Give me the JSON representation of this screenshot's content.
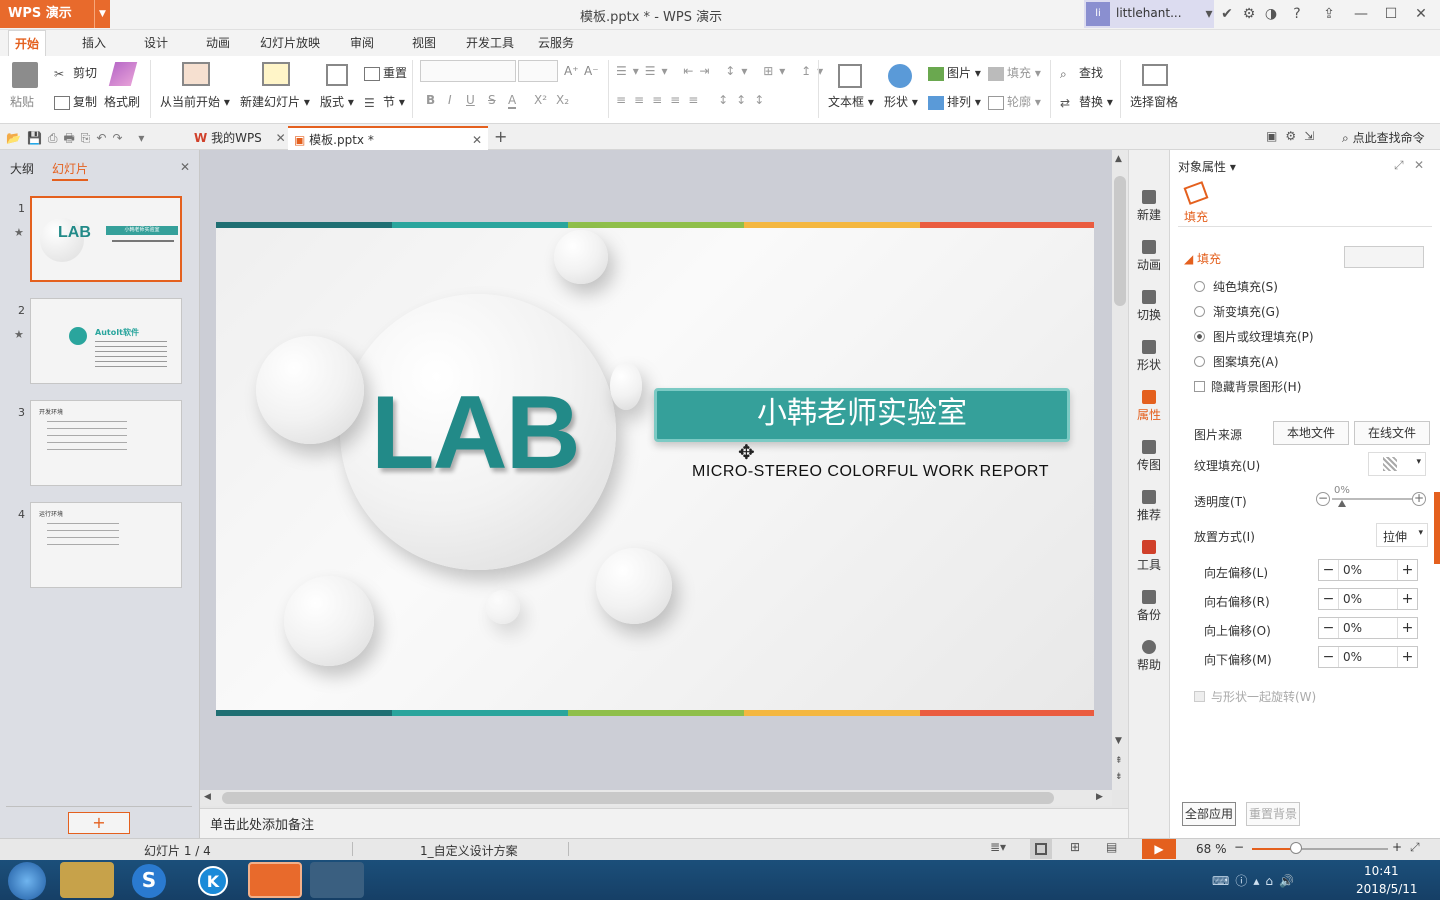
{
  "titlebar": {
    "app_name": "WPS 演示",
    "doc_title": "模板.pptx * - WPS 演示",
    "username": "littlehant...",
    "avatar_text": "li",
    "help": "?"
  },
  "menu": {
    "tabs": [
      "开始",
      "插入",
      "设计",
      "动画",
      "幻灯片放映",
      "审阅",
      "视图",
      "开发工具",
      "云服务"
    ]
  },
  "ribbon": {
    "paste": "粘贴",
    "cut": "剪切",
    "copy": "复制",
    "format_painter": "格式刷",
    "from_current": "从当前开始",
    "new_slide": "新建幻灯片",
    "layout": "版式",
    "reset": "重置",
    "section": "节",
    "textbox": "文本框",
    "shape": "形状",
    "picture": "图片",
    "fill": "填充",
    "arrange": "排列",
    "outline": "轮廓",
    "find": "查找",
    "replace": "替换",
    "selection_pane": "选择窗格",
    "font_increase": "A⁺",
    "font_decrease": "A⁻",
    "bold": "B",
    "italic": "I",
    "underline": "U",
    "strike": "S",
    "font_color": "A",
    "superscript": "X²",
    "subscript": "X₂"
  },
  "doc_tabs": {
    "my_wps": "我的WPS",
    "file": "模板.pptx *",
    "search_cmd": "点此查找命令"
  },
  "left_panel": {
    "tab_outline": "大纲",
    "tab_slides": "幻灯片",
    "slides": [
      {
        "num": "1",
        "star": "★",
        "title": "LAB",
        "sub": "小韩老师实验室"
      },
      {
        "num": "2",
        "star": "★",
        "title": "AutoIt软件"
      },
      {
        "num": "3",
        "star": "",
        "title": "开发环境"
      },
      {
        "num": "4",
        "star": "",
        "title": "运行环境"
      }
    ],
    "add_button": "+"
  },
  "slide": {
    "logo_text": "LAB",
    "title": "小韩老师实验室",
    "subtitle": "MICRO-STEREO COLORFUL WORK REPORT",
    "bar_colors": [
      "#1f6f73",
      "#2aa59d",
      "#8fbf4a",
      "#f4b740",
      "#ea5c40"
    ]
  },
  "notes": {
    "placeholder": "单击此处添加备注"
  },
  "side_tools": [
    "新建",
    "动画",
    "切换",
    "形状",
    "属性",
    "传图",
    "推荐",
    "工具",
    "备份",
    "帮助"
  ],
  "props": {
    "header": "对象属性",
    "tab_fill": "填充",
    "section_fill": "填充",
    "options": [
      "纯色填充(S)",
      "渐变填充(G)",
      "图片或纹理填充(P)",
      "图案填充(A)"
    ],
    "selected_option": "图片或纹理填充(P)",
    "hide_bg": "隐藏背景图形(H)",
    "source_label": "图片来源",
    "local_file": "本地文件",
    "online_file": "在线文件",
    "texture_label": "纹理填充(U)",
    "transparency_label": "透明度(T)",
    "transparency_value": "0%",
    "placement_label": "放置方式(I)",
    "placement_value": "拉伸",
    "offsets": [
      {
        "label": "向左偏移(L)",
        "value": "0%"
      },
      {
        "label": "向右偏移(R)",
        "value": "0%"
      },
      {
        "label": "向上偏移(O)",
        "value": "0%"
      },
      {
        "label": "向下偏移(M)",
        "value": "0%"
      }
    ],
    "rotate_with_shape": "与形状一起旋转(W)",
    "apply_all": "全部应用",
    "reset_bg": "重置背景"
  },
  "status": {
    "slide_info": "幻灯片 1 / 4",
    "theme": "1_自定义设计方案",
    "zoom": "68 %"
  },
  "taskbar": {
    "time": "10:41",
    "date": "2018/5/11"
  },
  "colors": {
    "accent": "#e4601e",
    "teal": "#35a09a",
    "lab": "#228a88"
  }
}
